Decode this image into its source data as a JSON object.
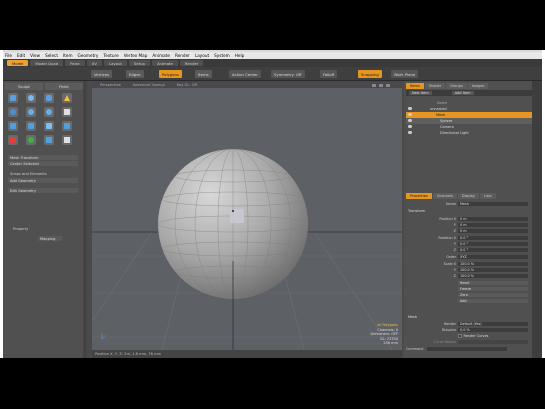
{
  "menu": [
    "File",
    "Edit",
    "View",
    "Select",
    "Item",
    "Geometry",
    "Texture",
    "Vertex Map",
    "Animate",
    "Render",
    "Layout",
    "System",
    "Help"
  ],
  "layout_tabs": [
    {
      "label": "Model",
      "active": true
    },
    {
      "label": "Model Quad",
      "active": false
    },
    {
      "label": "Paint",
      "active": false
    },
    {
      "label": "UV",
      "active": false
    },
    {
      "label": "Layout",
      "active": false
    },
    {
      "label": "Setup",
      "active": false
    },
    {
      "label": "Animate",
      "active": false
    },
    {
      "label": "Render",
      "active": false
    }
  ],
  "toolbar": {
    "vertices": "Vertices",
    "edges": "Edges",
    "polygons": "Polygons",
    "items": "Items",
    "action_center": "Action Center",
    "symmetry": "Symmetry: Off",
    "falloff": "Falloff",
    "snapping": "Snapping",
    "work_plane": "Work Plane"
  },
  "left_panel": {
    "tabs": [
      "Sculpt",
      "Paint"
    ],
    "tool_rows": [
      "Mesh Transform",
      "Center Selected"
    ],
    "snaps_heading": "Snaps and Elements",
    "snap_rows": [
      "Add Geometry",
      "Edit Geometry"
    ],
    "property_label": "Property",
    "property_value": "Mapping"
  },
  "viewport": {
    "header": [
      "Perspective",
      "Advanced Opengl",
      "Ray GL: Off"
    ],
    "hud": [
      "all Polygons",
      "Channels: 0",
      "Deformers: OFF",
      "GL: 23330",
      "256 mm"
    ],
    "status": "Position X, Y, Z:  2m, 1.8 mm, 76 mm"
  },
  "right_panel": {
    "top_tabs": [
      {
        "label": "Items",
        "active": true
      },
      {
        "label": "Shader",
        "active": false
      },
      {
        "label": "Groups",
        "active": false
      },
      {
        "label": "Images",
        "active": false
      }
    ],
    "item_list_header": [
      "New Item",
      "Add Item"
    ],
    "items": [
      "Name",
      "unnamed",
      "Mesh",
      "Sphere",
      "Camera",
      "Directional Light"
    ],
    "prop_tabs": [
      {
        "label": "Properties",
        "active": true
      },
      {
        "label": "Channels",
        "active": false
      },
      {
        "label": "Display",
        "active": false
      },
      {
        "label": "Lists",
        "active": false
      }
    ],
    "name_label": "Name",
    "name_value": "Mesh",
    "transform_heading": "Transform",
    "props": [
      {
        "label": "Position X",
        "value": "0 m"
      },
      {
        "label": "Y",
        "value": "0 m"
      },
      {
        "label": "Z",
        "value": "0 m"
      },
      {
        "label": "Rotation X",
        "value": "0.0 °"
      },
      {
        "label": "Y",
        "value": "0.0 °"
      },
      {
        "label": "Z",
        "value": "0.0 °"
      },
      {
        "label": "Order",
        "value": "XYZ"
      },
      {
        "label": "Scale X",
        "value": "100.0 %"
      },
      {
        "label": "Y",
        "value": "100.0 %"
      },
      {
        "label": "Z",
        "value": "100.0 %"
      }
    ],
    "reset_buttons": [
      "Reset",
      "Freeze",
      "Zero",
      "Add"
    ],
    "mesh_heading": "Mesh",
    "mesh_props": [
      {
        "label": "Render",
        "value": "Default (Yes)"
      },
      {
        "label": "Dissolve",
        "value": "0.0 %"
      }
    ],
    "smooth_label": "Render Curves",
    "curve_radius_label": "Curve Radius",
    "command_label": "Command"
  }
}
